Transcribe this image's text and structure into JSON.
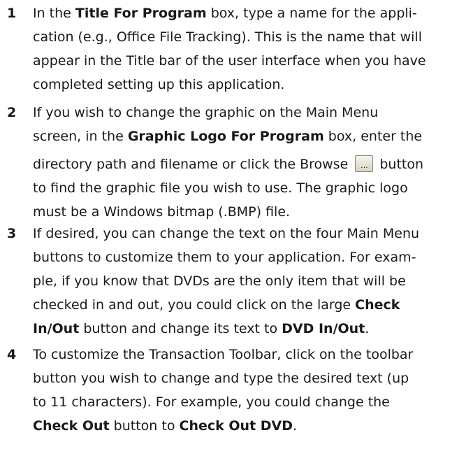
{
  "steps": [
    {
      "number": "1",
      "lines": [
        {
          "parts": [
            {
              "t": "In the "
            },
            {
              "t": "Title For Program",
              "b": true
            },
            {
              "t": " box, type a name for the appli-"
            }
          ]
        },
        {
          "parts": [
            {
              "t": "cation (e.g., Office File Tracking). This is the name that will"
            }
          ]
        },
        {
          "parts": [
            {
              "t": "appear in the Title bar of the user interface when you have"
            }
          ]
        },
        {
          "parts": [
            {
              "t": "completed setting up this application."
            }
          ]
        }
      ]
    },
    {
      "number": "2",
      "lines": [
        {
          "parts": [
            {
              "t": "If you wish to change the graphic on the Main Menu"
            }
          ]
        },
        {
          "parts": [
            {
              "t": "screen, in the "
            },
            {
              "t": "Graphic Logo For Program",
              "b": true
            },
            {
              "t": " box, enter the"
            }
          ]
        },
        {
          "parts": [
            {
              "t": "directory path and filename or click the Browse "
            },
            {
              "icon": "browse-button-icon",
              "label": "..."
            },
            {
              "t": " button"
            }
          ]
        },
        {
          "parts": [
            {
              "t": "to find the graphic file you wish to use. The graphic logo"
            }
          ]
        },
        {
          "parts": [
            {
              "t": "must be a Windows bitmap (.BMP) file."
            }
          ]
        }
      ]
    },
    {
      "number": "3",
      "lines": [
        {
          "parts": [
            {
              "t": "If desired, you can change the text on the four Main Menu"
            }
          ]
        },
        {
          "parts": [
            {
              "t": "buttons to customize them to your application. For exam-"
            }
          ]
        },
        {
          "parts": [
            {
              "t": "ple, if you know that DVDs are the only item that will be"
            }
          ]
        },
        {
          "parts": [
            {
              "t": "checked in and out, you could click on the large "
            },
            {
              "t": "Check",
              "b": true
            }
          ]
        },
        {
          "parts": [
            {
              "t": "In/Out",
              "b": true
            },
            {
              "t": " button and change its text to "
            },
            {
              "t": "DVD In/Out",
              "b": true
            },
            {
              "t": "."
            }
          ]
        }
      ]
    },
    {
      "number": "4",
      "lines": [
        {
          "parts": [
            {
              "t": "To customize the Transaction Toolbar, click on the toolbar"
            }
          ]
        },
        {
          "parts": [
            {
              "t": "button you wish to change and type the desired text (up"
            }
          ]
        },
        {
          "parts": [
            {
              "t": "to 11 characters). For example, you could change the"
            }
          ]
        },
        {
          "parts": [
            {
              "t": "Check Out",
              "b": true
            },
            {
              "t": " button to "
            },
            {
              "t": "Check Out DVD",
              "b": true
            },
            {
              "t": "."
            }
          ]
        }
      ]
    }
  ]
}
